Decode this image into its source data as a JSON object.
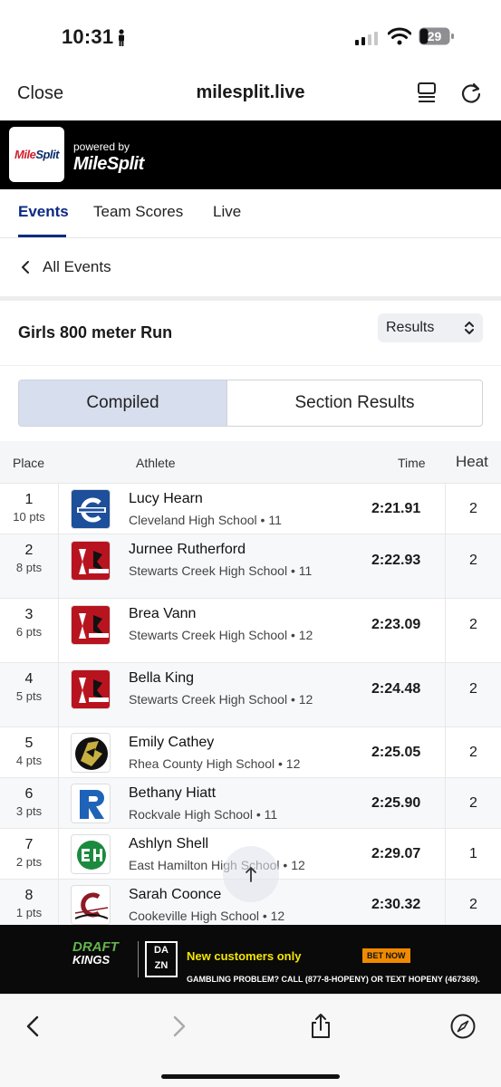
{
  "status_bar": {
    "time": "10:31",
    "battery": "29"
  },
  "browser": {
    "close_label": "Close",
    "url": "milesplit.live"
  },
  "banner": {
    "logo_text_a": "Mile",
    "logo_text_b": "Split",
    "powered_by": "powered by",
    "brand": "MileSplit"
  },
  "tabs": [
    {
      "label": "Events",
      "active": true
    },
    {
      "label": "Team Scores"
    },
    {
      "label": "Live"
    }
  ],
  "nav": {
    "back_label": "All Events"
  },
  "event": {
    "title": "Girls 800 meter Run",
    "view_select": "Results"
  },
  "segments": {
    "compiled": "Compiled",
    "section_results": "Section Results"
  },
  "table": {
    "headers": {
      "place": "Place",
      "athlete": "Athlete",
      "time": "Time",
      "heat": "Heat"
    },
    "rows": [
      {
        "place": "1",
        "pts": "10 pts",
        "name": "Lucy Hearn",
        "school": "Cleveland High School • 11",
        "time": "2:21.91",
        "heat": "2",
        "crest": "cleveland"
      },
      {
        "place": "2",
        "pts": "8 pts",
        "name": "Jurnee Rutherford",
        "school": "Stewarts Creek High School • 11",
        "time": "2:22.93",
        "heat": "2",
        "crest": "stewarts"
      },
      {
        "place": "3",
        "pts": "6 pts",
        "name": "Brea Vann",
        "school": "Stewarts Creek High School • 12",
        "time": "2:23.09",
        "heat": "2",
        "crest": "stewarts"
      },
      {
        "place": "4",
        "pts": "5 pts",
        "name": "Bella King",
        "school": "Stewarts Creek High School • 12",
        "time": "2:24.48",
        "heat": "2",
        "crest": "stewarts"
      },
      {
        "place": "5",
        "pts": "4 pts",
        "name": "Emily Cathey",
        "school": "Rhea County High School • 12",
        "time": "2:25.05",
        "heat": "2",
        "crest": "rhea"
      },
      {
        "place": "6",
        "pts": "3 pts",
        "name": "Bethany Hiatt",
        "school": "Rockvale High School • 11",
        "time": "2:25.90",
        "heat": "2",
        "crest": "rockvale"
      },
      {
        "place": "7",
        "pts": "2 pts",
        "name": "Ashlyn Shell",
        "school": "East Hamilton High School • 12",
        "time": "2:29.07",
        "heat": "1",
        "crest": "easthamilton"
      },
      {
        "place": "8",
        "pts": "1 pts",
        "name": "Sarah Coonce",
        "school": "Cookeville High School • 12",
        "time": "2:30.32",
        "heat": "2",
        "crest": "cookeville"
      }
    ]
  },
  "ad": {
    "brand1": "DRAFT",
    "brand1b": "KINGS",
    "brand2": "DA ZN",
    "headline": "New customers only",
    "cta": "BET NOW",
    "disclaimer": "GAMBLING PROBLEM? CALL (877-8-HOPENY) OR TEXT HOPENY (467369)."
  }
}
